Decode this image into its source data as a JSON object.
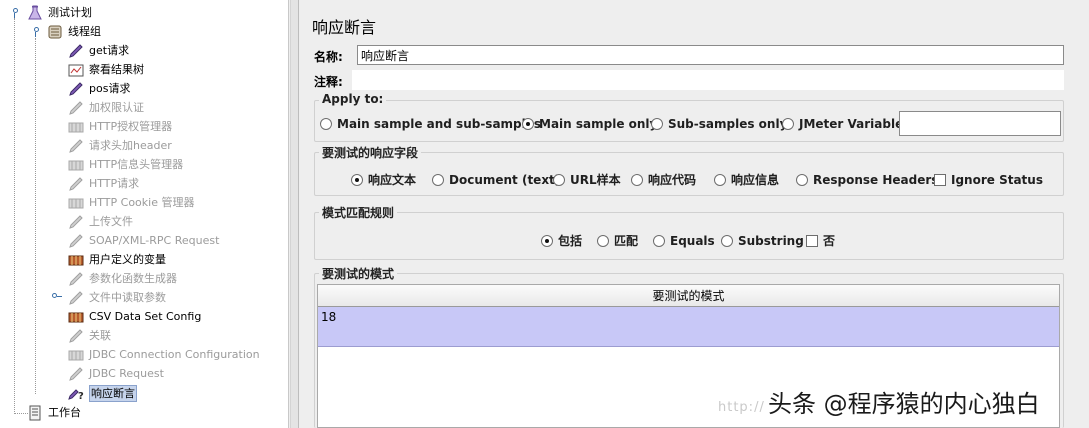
{
  "tree": {
    "items": [
      {
        "label": "测试计划",
        "icon": "flask-icon",
        "state": "normal"
      },
      {
        "label": "线程组",
        "icon": "thread-group-icon",
        "state": "normal"
      },
      {
        "label": "get请求",
        "icon": "sampler-pen-icon",
        "state": "normal"
      },
      {
        "label": "察看结果树",
        "icon": "listener-chart-icon",
        "state": "normal"
      },
      {
        "label": "pos请求",
        "icon": "sampler-pen-icon",
        "state": "normal"
      },
      {
        "label": "加权限认证",
        "icon": "sampler-pen-icon",
        "state": "disabled"
      },
      {
        "label": "HTTP授权管理器",
        "icon": "config-element-icon",
        "state": "disabled"
      },
      {
        "label": "请求头加header",
        "icon": "sampler-pen-icon",
        "state": "disabled"
      },
      {
        "label": "HTTP信息头管理器",
        "icon": "config-element-icon",
        "state": "disabled"
      },
      {
        "label": "HTTP请求",
        "icon": "sampler-pen-icon",
        "state": "disabled"
      },
      {
        "label": "HTTP Cookie 管理器",
        "icon": "config-element-icon",
        "state": "disabled"
      },
      {
        "label": "上传文件",
        "icon": "sampler-pen-icon",
        "state": "disabled"
      },
      {
        "label": "SOAP/XML-RPC Request",
        "icon": "sampler-pen-icon",
        "state": "disabled"
      },
      {
        "label": "用户定义的变量",
        "icon": "config-element-icon",
        "state": "normal"
      },
      {
        "label": "参数化函数生成器",
        "icon": "sampler-pen-icon",
        "state": "disabled"
      },
      {
        "label": "文件中读取参数",
        "icon": "sampler-pen-icon",
        "state": "disabled"
      },
      {
        "label": "CSV Data Set Config",
        "icon": "config-element-icon",
        "state": "normal"
      },
      {
        "label": "关联",
        "icon": "sampler-pen-icon",
        "state": "disabled"
      },
      {
        "label": "JDBC Connection Configuration",
        "icon": "config-element-icon",
        "state": "disabled"
      },
      {
        "label": "JDBC Request",
        "icon": "sampler-pen-icon",
        "state": "disabled"
      },
      {
        "label": "响应断言",
        "icon": "assertion-icon",
        "state": "selected"
      },
      {
        "label": "工作台",
        "icon": "workbench-icon",
        "state": "normal"
      }
    ]
  },
  "panel": {
    "title": "响应断言",
    "name_label": "名称:",
    "name_value": "响应断言",
    "comment_label": "注释:",
    "comment_value": ""
  },
  "apply_to": {
    "title": "Apply to:",
    "options": [
      "Main sample and sub-samples",
      "Main sample only",
      "Sub-samples only",
      "JMeter Variable"
    ],
    "selected": "Main sample only",
    "variable_value": ""
  },
  "response_field": {
    "title": "要测试的响应字段",
    "options": [
      "响应文本",
      "Document (text)",
      "URL样本",
      "响应代码",
      "响应信息",
      "Response Headers"
    ],
    "selected": "响应文本",
    "ignore_status_label": "Ignore Status",
    "ignore_status_checked": false
  },
  "pattern_rules": {
    "title": "模式匹配规则",
    "options": [
      "包括",
      "匹配",
      "Equals",
      "Substring"
    ],
    "selected": "包括",
    "not_label": "否",
    "not_checked": false
  },
  "patterns": {
    "title": "要测试的模式",
    "column_header": "要测试的模式",
    "rows": [
      "18"
    ]
  },
  "watermark": {
    "url_text": "http://",
    "text": "头条 @程序猿的内心独白"
  },
  "colors": {
    "selection_row": "#c8c8f7",
    "tree_selected": "#c6d4ec",
    "disabled_text": "#9b9b9b"
  }
}
